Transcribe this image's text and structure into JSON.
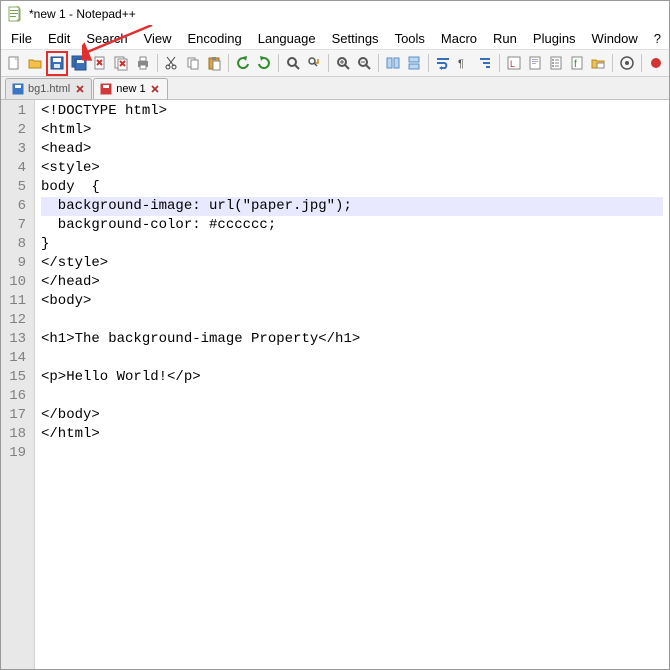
{
  "window": {
    "title": "*new 1 - Notepad++"
  },
  "menu": {
    "items": [
      "File",
      "Edit",
      "Search",
      "View",
      "Encoding",
      "Language",
      "Settings",
      "Tools",
      "Macro",
      "Run",
      "Plugins",
      "Window",
      "?"
    ]
  },
  "toolbar": {
    "buttons": [
      {
        "name": "new-file-icon",
        "title": "New"
      },
      {
        "name": "open-file-icon",
        "title": "Open"
      },
      {
        "name": "save-icon",
        "title": "Save",
        "highlighted": true
      },
      {
        "name": "save-all-icon",
        "title": "Save All"
      },
      {
        "name": "close-file-icon",
        "title": "Close"
      },
      {
        "name": "close-all-icon",
        "title": "Close All"
      },
      {
        "name": "print-icon",
        "title": "Print"
      },
      {
        "sep": true
      },
      {
        "name": "cut-icon",
        "title": "Cut"
      },
      {
        "name": "copy-icon",
        "title": "Copy"
      },
      {
        "name": "paste-icon",
        "title": "Paste"
      },
      {
        "sep": true
      },
      {
        "name": "undo-icon",
        "title": "Undo"
      },
      {
        "name": "redo-icon",
        "title": "Redo"
      },
      {
        "sep": true
      },
      {
        "name": "find-icon",
        "title": "Find"
      },
      {
        "name": "replace-icon",
        "title": "Replace"
      },
      {
        "sep": true
      },
      {
        "name": "zoom-in-icon",
        "title": "Zoom In"
      },
      {
        "name": "zoom-out-icon",
        "title": "Zoom Out"
      },
      {
        "sep": true
      },
      {
        "name": "sync-v-icon",
        "title": "Sync Vertical"
      },
      {
        "name": "sync-h-icon",
        "title": "Sync Horizontal"
      },
      {
        "sep": true
      },
      {
        "name": "wordwrap-icon",
        "title": "Word Wrap"
      },
      {
        "name": "show-all-chars-icon",
        "title": "Show All Chars"
      },
      {
        "name": "indent-guide-icon",
        "title": "Indent Guide"
      },
      {
        "sep": true
      },
      {
        "name": "udl-icon",
        "title": "User Lang"
      },
      {
        "name": "doc-map-icon",
        "title": "Doc Map"
      },
      {
        "name": "doc-list-icon",
        "title": "Doc List"
      },
      {
        "name": "func-list-icon",
        "title": "Function List"
      },
      {
        "name": "folder-workspace-icon",
        "title": "Folder as Workspace"
      },
      {
        "sep": true
      },
      {
        "name": "monitoring-icon",
        "title": "Monitoring"
      },
      {
        "sep": true
      },
      {
        "name": "record-macro-icon",
        "title": "Record Macro"
      }
    ]
  },
  "tabs": [
    {
      "label": "bg1.html",
      "active": false,
      "dirty": false,
      "icon_color": "#3a76c4"
    },
    {
      "label": "new 1",
      "active": true,
      "dirty": true,
      "icon_color": "#d23a3a"
    }
  ],
  "editor": {
    "highlighted_line": 6,
    "lines": [
      "<!DOCTYPE html>",
      "<html>",
      "<head>",
      "<style>",
      "body  {",
      "  background-image: url(\"paper.jpg\");",
      "  background-color: #cccccc;",
      "}",
      "</style>",
      "</head>",
      "<body>",
      "",
      "<h1>The background-image Property</h1>",
      "",
      "<p>Hello World!</p>",
      "",
      "</body>",
      "</html>",
      ""
    ]
  },
  "annotation": {
    "arrow_color": "#e03030"
  }
}
